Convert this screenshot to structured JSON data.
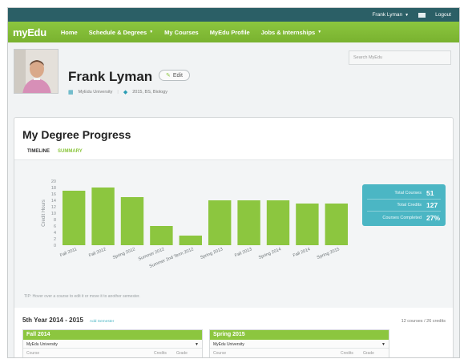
{
  "topbar": {
    "user": "Frank Lyman",
    "logout": "Logout"
  },
  "nav": {
    "logo": "myEdu",
    "items": [
      {
        "label": "Home"
      },
      {
        "label": "Schedule & Degrees",
        "caret": true
      },
      {
        "label": "My Courses"
      },
      {
        "label": "MyEdu Profile"
      },
      {
        "label": "Jobs & Internships",
        "caret": true
      }
    ]
  },
  "profile": {
    "name": "Frank Lyman",
    "edit_label": "Edit",
    "school": "MyEdu University",
    "degree": "2015, BS, Biology",
    "search_placeholder": "Search MyEdu"
  },
  "degree": {
    "title": "My Degree Progress",
    "tabs": [
      {
        "label": "TIMELINE"
      },
      {
        "label": "SUMMARY"
      }
    ],
    "tip": "TIP: Hover over a course to edit it or move it to another semester.",
    "stats": [
      {
        "label": "Total Courses",
        "value": "51"
      },
      {
        "label": "Total Credits",
        "value": "127"
      },
      {
        "label": "Courses Completed",
        "value": "27%"
      }
    ],
    "year": {
      "title": "5th Year 2014 - 2015",
      "add": "Add Semester",
      "count": "12 courses / 26 credits"
    },
    "semesters": [
      {
        "term": "Fall 2014",
        "school": "MyEdu University",
        "col_course": "Course",
        "col_credits": "Credits",
        "col_grade": "Grade"
      },
      {
        "term": "Spring 2015",
        "school": "MyEdu University",
        "col_course": "Course",
        "col_credits": "Credits",
        "col_grade": "Grade"
      }
    ]
  },
  "colors": {
    "green": "#8cc63f",
    "teal": "#4bb6c4",
    "topbar": "#2b5f66"
  },
  "chart_data": {
    "type": "bar",
    "ylabel": "Credit Hours",
    "ylim": [
      0,
      20
    ],
    "yticks": [
      0,
      2,
      4,
      6,
      8,
      10,
      12,
      14,
      16,
      18,
      20
    ],
    "categories": [
      "Fall 2011",
      "Fall 2012",
      "Spring 2012",
      "Summer 2012",
      "Summer 2nd Term 2012",
      "Spring 2013",
      "Fall 2013",
      "Spring 2014",
      "Fall 2014",
      "Spring 2015"
    ],
    "values": [
      17,
      18,
      15,
      6,
      3,
      14,
      14,
      14,
      13,
      13
    ]
  }
}
